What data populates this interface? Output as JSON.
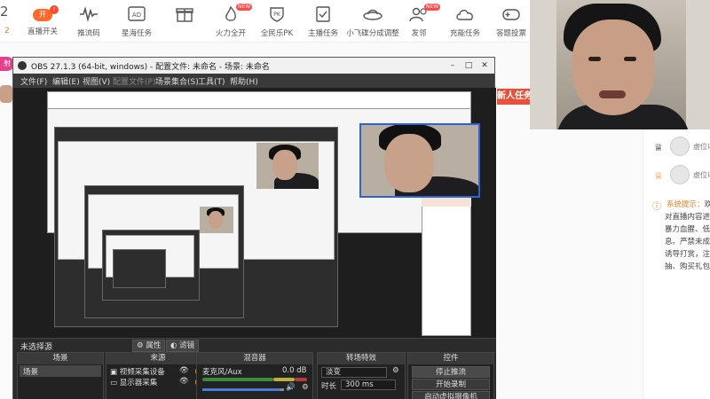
{
  "toolbar": {
    "count": "2",
    "sub": "2",
    "live_toggle": "开",
    "live_badge": "!",
    "new_badge": "NEW",
    "items": [
      "直播开关",
      "推流码",
      "星海任务",
      "",
      "火力全开",
      "全民乐PK",
      "主播任务",
      "小飞碟分成调整",
      "发邻",
      "充能任务",
      "答题投票"
    ]
  },
  "left": {
    "pill": "射"
  },
  "new_task": "新人任务",
  "side": {
    "user_name": "虚位以",
    "system_title": "系统提示：",
    "system_suffix": "欢",
    "system_lines": [
      "对直播内容进行",
      "暴力血腥、低俗",
      "息。严禁未成年",
      "诱导打赏，注意",
      "抽、购买礼包的"
    ]
  },
  "obs": {
    "title": "OBS 27.1.3 (64-bit, windows) - 配置文件: 未命名 - 场景: 未命名",
    "menu": [
      {
        "label": "文件(F)",
        "dim": false
      },
      {
        "label": "编辑(E)",
        "dim": false
      },
      {
        "label": "视图(V)",
        "dim": false
      },
      {
        "label": "配置文件(P)",
        "dim": true
      },
      {
        "label": "场景集合(S)",
        "dim": false
      },
      {
        "label": "工具(T)",
        "dim": false
      },
      {
        "label": "帮助(H)",
        "dim": false
      }
    ],
    "status_label": "未选择源",
    "properties_btn": "属性",
    "filters_btn": "滤镜",
    "docks": {
      "scenes_header": "场景",
      "sources_header": "来源",
      "mixer_header": "混音器",
      "transitions_header": "转场特效",
      "controls_header": "控件",
      "scene_item": "场景",
      "sources": [
        "视频采集设备",
        "显示器采集"
      ],
      "mixer_track": "麦克风/Aux",
      "mixer_db": "0.0 dB",
      "transition": "淡变",
      "duration_label": "时长",
      "duration_value": "300 ms",
      "buttons": [
        "停止推流",
        "开始录制",
        "启动虚拟摄像机"
      ]
    }
  }
}
